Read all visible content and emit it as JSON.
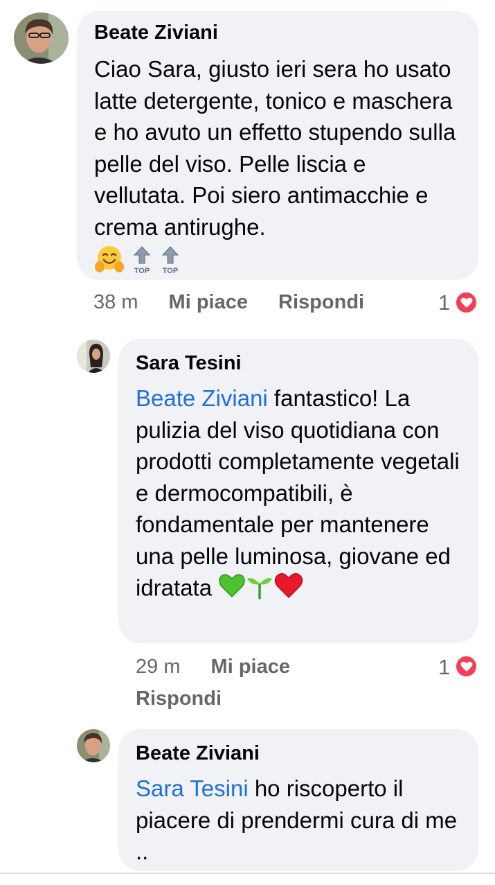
{
  "comments": [
    {
      "author": "Beate Ziviani",
      "text": "Ciao Sara, giusto ieri sera ho usato latte detergente, tonico e maschera e ho avuto un effetto stupendo sulla pelle del viso. Pelle liscia e vellutata. Poi siero antimacchie e crema antirughe.",
      "emojis": [
        "hugging-face",
        "top-arrow",
        "top-arrow"
      ],
      "top_label": "TOP",
      "time": "38 m",
      "like_label": "Mi piace",
      "reply_label": "Rispondi",
      "reaction_count": "1"
    },
    {
      "author": "Sara Tesini",
      "mention": "Beate Ziviani",
      "text": " fantastico! La pulizia del viso quotidiana con prodotti completamente vegetali  e dermocompatibili, è fondamentale per mantenere una pelle luminosa, giovane ed idratata",
      "emojis": [
        "green-heart",
        "seedling",
        "red-heart"
      ],
      "time": "29 m",
      "like_label": "Mi piace",
      "reply_label": "Rispondi",
      "reaction_count": "1"
    },
    {
      "author": "Beate Ziviani",
      "mention": "Sara Tesini",
      "text": " ho riscoperto il piacere di prendermi cura di me .."
    }
  ],
  "colors": {
    "bubble": "#f0f2f5",
    "mention": "#216fdb",
    "meta": "#65676b",
    "heart_reaction": "#f33e58"
  }
}
